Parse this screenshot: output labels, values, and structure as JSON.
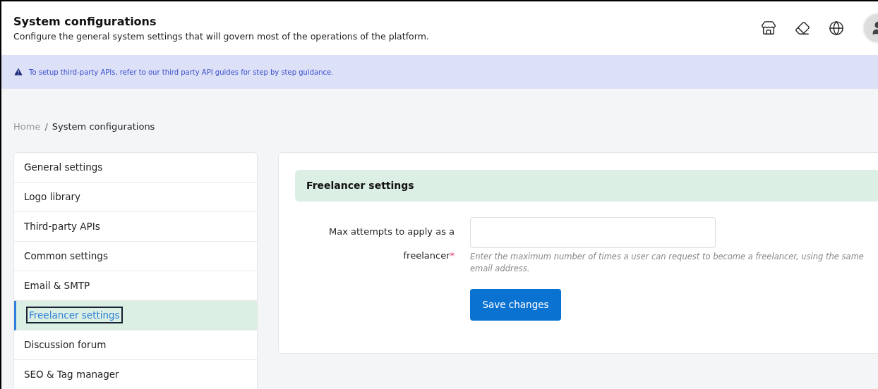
{
  "header": {
    "title": "System configurations",
    "subtitle": "Configure the general system settings that will govern most of the operations of the platform."
  },
  "banner": {
    "text": "To setup third-party APIs, refer to our third party API guides for step by step guidance."
  },
  "breadcrumb": {
    "separator": "/",
    "items": [
      {
        "label": "Home",
        "current": false
      },
      {
        "label": "System configurations",
        "current": true
      }
    ]
  },
  "sidebar": {
    "items": [
      {
        "label": "General settings",
        "selected": false
      },
      {
        "label": "Logo library",
        "selected": false
      },
      {
        "label": "Third-party APIs",
        "selected": false
      },
      {
        "label": "Common settings",
        "selected": false
      },
      {
        "label": "Email & SMTP",
        "selected": false
      },
      {
        "label": "Freelancer settings",
        "selected": true
      },
      {
        "label": "Discussion forum",
        "selected": false
      },
      {
        "label": "SEO & Tag manager",
        "selected": false
      }
    ]
  },
  "panel": {
    "title": "Freelancer settings",
    "field": {
      "label_lines": [
        "Max attempts to apply as a",
        "freelancer"
      ],
      "required_mark": "*",
      "help": "Enter the maximum number of times a user can request to become a freelancer, using the same email address."
    },
    "save_button": "Save changes"
  }
}
